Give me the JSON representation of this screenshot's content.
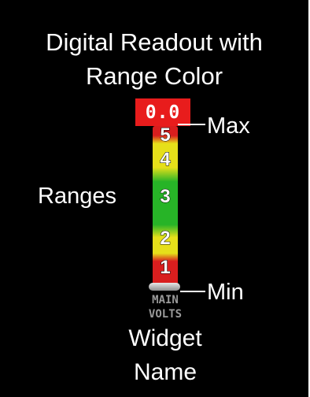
{
  "title": {
    "line1": "Digital Readout with",
    "line2": "Range Color"
  },
  "readout": {
    "value": "0.0",
    "background_color": "#e81c1c"
  },
  "gauge": {
    "range_colors": [
      "#d81e1e",
      "#e6df1a",
      "#27b427",
      "#e6df1a",
      "#d81e1e"
    ],
    "numbers": [
      "5",
      "4",
      "3",
      "2",
      "1"
    ]
  },
  "widget": {
    "label_line1": "MAIN",
    "label_line2": "VOLTS"
  },
  "callouts": {
    "max": "Max",
    "min": "Min",
    "ranges": "Ranges",
    "name_line1": "Widget",
    "name_line2": "Name"
  }
}
